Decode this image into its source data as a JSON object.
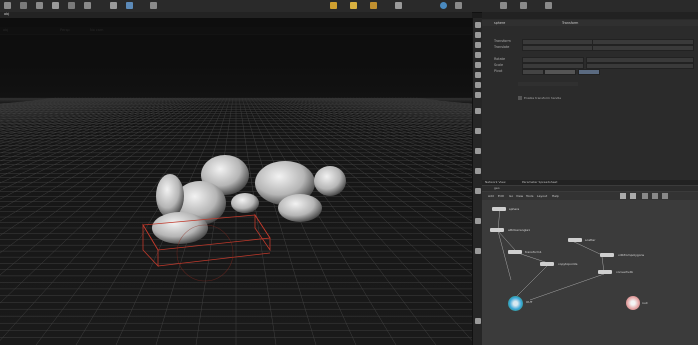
{
  "window": {
    "tab_label": "obj"
  },
  "top_toolbar": {
    "icons": [
      "shelf-icon-1",
      "shelf-icon-2",
      "shelf-icon-3",
      "shelf-icon-4",
      "shelf-icon-5",
      "shelf-icon-6",
      "shelf-icon-7",
      "shelf-icon-8",
      "shelf-icon-9",
      "shelf-icon-10",
      "shelf-icon-11",
      "shelf-icon-12"
    ]
  },
  "viewport": {
    "view_label": "obj",
    "mode_label": "Persp",
    "camera_label": "No cam"
  },
  "parameters": {
    "path_label": "sphere",
    "node_type": "Transform",
    "rows": [
      {
        "label": "Transform",
        "value": ""
      },
      {
        "label": "Translate",
        "value": ""
      },
      {
        "label": "Rotate",
        "value": ""
      },
      {
        "label": "Scale",
        "value": ""
      },
      {
        "label": "Pivot",
        "value": ""
      }
    ],
    "checkbox_label": "Enable transform handle"
  },
  "network": {
    "tabs": [
      "Network View",
      "Parameter Spreadsheet"
    ],
    "path_label": "geo",
    "menu": [
      "Add",
      "Edit",
      "Go",
      "View",
      "Tools",
      "Layout",
      "Help"
    ],
    "nodes": [
      {
        "name": "null1",
        "label": "sphere",
        "color": "#cfcfcf"
      },
      {
        "name": "node2",
        "label": "attribwrangle1",
        "color": "#cfcfcf"
      },
      {
        "name": "node3",
        "label": "transform1",
        "color": "#cfcfcf"
      },
      {
        "name": "node4",
        "label": "scatter",
        "color": "#cfcfcf"
      },
      {
        "name": "node5",
        "label": "copytopoints",
        "color": "#cfcfcf"
      },
      {
        "name": "node6",
        "label": "vdbfrompolygons",
        "color": "#cfcfcf"
      },
      {
        "name": "node7",
        "label": "convertvdb",
        "color": "#cfcfcf"
      },
      {
        "name": "node8",
        "label": "OUT",
        "color": "#3aa6d8"
      },
      {
        "name": "node9",
        "label": "null",
        "color": "#e4a3a3"
      }
    ]
  },
  "colors": {
    "accent": "#e8c840",
    "selection": "#3aa6d8",
    "bbox": "#c0392b"
  }
}
